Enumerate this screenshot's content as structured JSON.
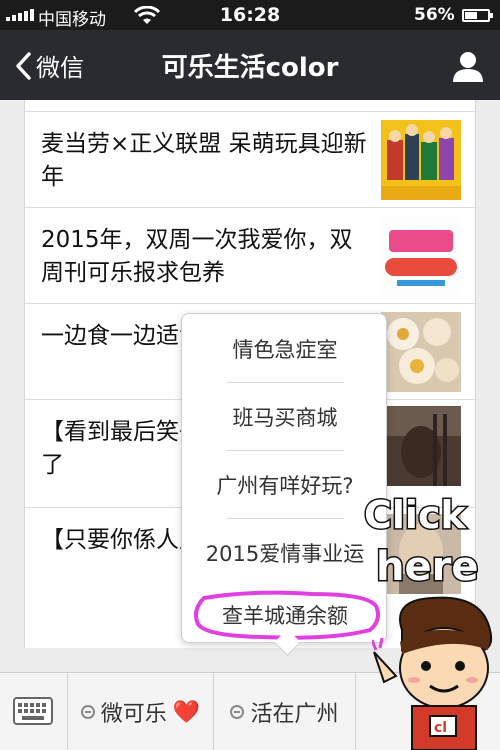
{
  "status_bar": {
    "carrier": "中国移动",
    "time": "16:28",
    "battery_percent": "56%",
    "battery_level": 0.56
  },
  "nav": {
    "back_label": "微信",
    "title": "可乐生活color"
  },
  "articles": [
    {
      "text": "麦当劳×正义联盟 呆萌玩具迎新年"
    },
    {
      "text": "2015年，双周一次我爱你，双周刊可乐报求包养"
    },
    {
      "text": "一边食一边适食埋嘢骑埋马"
    },
    {
      "text": "【看到最后笑子头卡在大铁出来了"
    },
    {
      "text": "【只要你係人广州人延长至鸠死"
    }
  ],
  "popup_menu": {
    "items": [
      {
        "label": "情色急症室"
      },
      {
        "label": "班马买商城"
      },
      {
        "label": "广州有咩好玩?"
      },
      {
        "label": "2015爱情事业运"
      },
      {
        "label": "查羊城通余额"
      }
    ],
    "highlight_color": "#e040e0"
  },
  "menu_bar": {
    "tabs": [
      {
        "label": "微可乐",
        "suffix": "❤️"
      },
      {
        "label": "活在广州"
      }
    ]
  },
  "decorations": {
    "click_here_line1": "Click",
    "click_here_line2": "here"
  },
  "colors": {
    "navbar": "#2a2b2f",
    "status_bar": "#1b1b1b",
    "heart": "#e0242c"
  }
}
